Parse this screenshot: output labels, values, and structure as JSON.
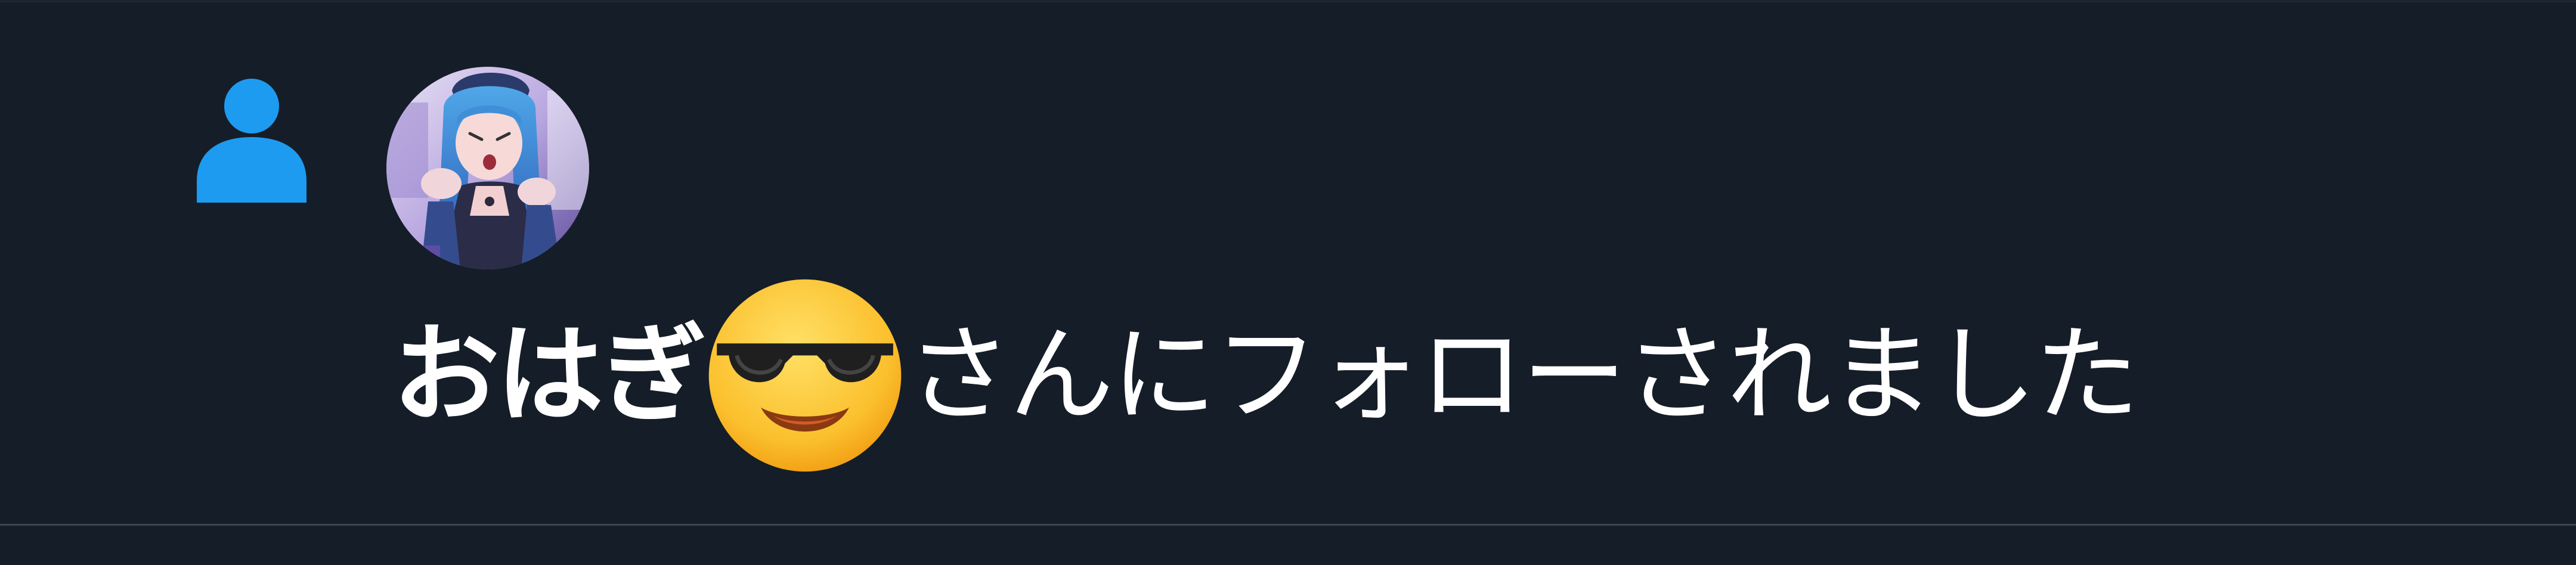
{
  "notification": {
    "type_icon": "person-icon",
    "avatar_icon": "user-avatar",
    "user_name": "おはぎ",
    "user_name_emoji": "smiling-face-with-sunglasses-emoji",
    "action_text": "さんにフォローされました"
  },
  "colors": {
    "background": "#151d28",
    "accent": "#1d9bf0",
    "text": "#ffffff",
    "divider": "#3a4553"
  }
}
